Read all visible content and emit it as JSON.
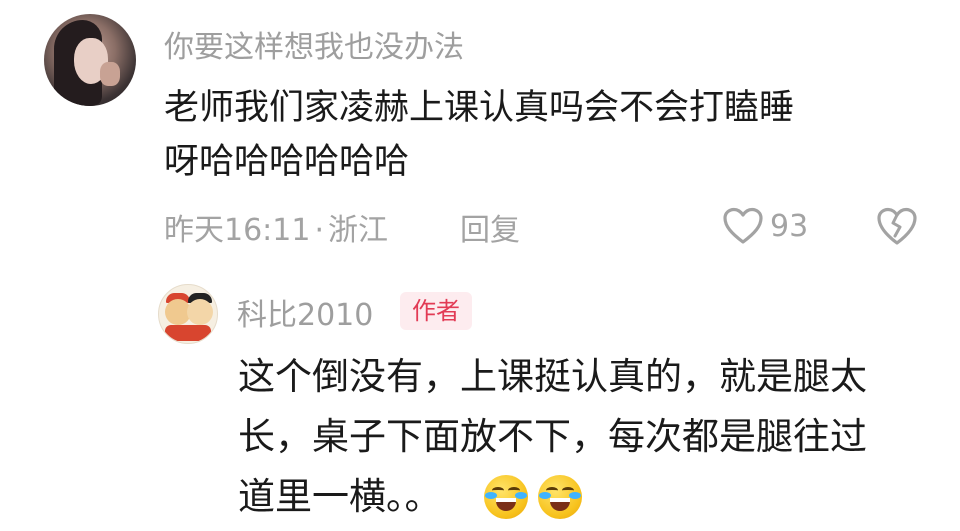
{
  "comment": {
    "username": "你要这样想我也没办法",
    "text_line1": "老师我们家凌赫上课认真吗会不会打瞌睡",
    "text_line2": "呀哈哈哈哈哈哈",
    "time": "昨天16:11",
    "separator": "·",
    "location": "浙江",
    "reply_label": "回复",
    "likes": "93",
    "like_icon": "heart-outline-icon",
    "dislike_icon": "broken-heart-icon"
  },
  "reply": {
    "username": "科比2010",
    "badge": "作者",
    "text_line1": "这个倒没有，上课挺认真的，就是腿太",
    "text_line2": "长，桌子下面放不下，每次都是腿往过",
    "text_line3": "道里一横。。",
    "emojis": [
      "laughing-crying-emoji",
      "laughing-crying-emoji"
    ]
  },
  "colors": {
    "meta_gray": "#a3a3a3",
    "badge_background": "#fdecef",
    "badge_text": "#e23b55"
  }
}
